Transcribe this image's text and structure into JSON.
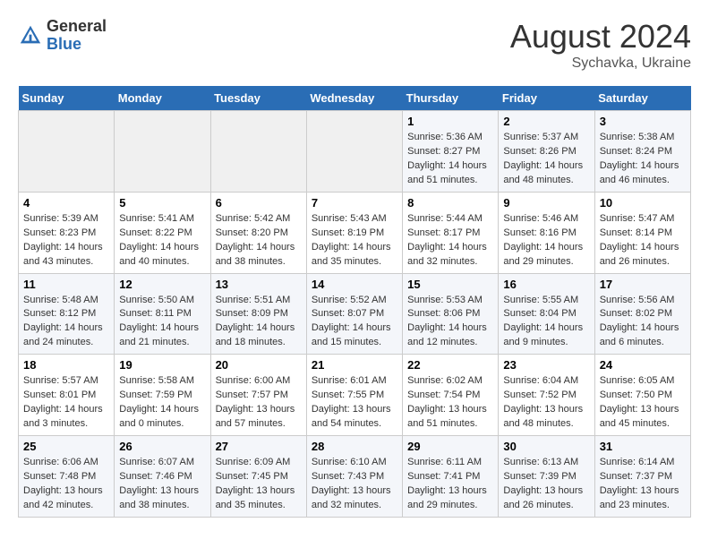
{
  "header": {
    "logo_general": "General",
    "logo_blue": "Blue",
    "month_year": "August 2024",
    "location": "Sychavka, Ukraine"
  },
  "days_of_week": [
    "Sunday",
    "Monday",
    "Tuesday",
    "Wednesday",
    "Thursday",
    "Friday",
    "Saturday"
  ],
  "weeks": [
    [
      {
        "day": "",
        "info": ""
      },
      {
        "day": "",
        "info": ""
      },
      {
        "day": "",
        "info": ""
      },
      {
        "day": "",
        "info": ""
      },
      {
        "day": "1",
        "info": "Sunrise: 5:36 AM\nSunset: 8:27 PM\nDaylight: 14 hours\nand 51 minutes."
      },
      {
        "day": "2",
        "info": "Sunrise: 5:37 AM\nSunset: 8:26 PM\nDaylight: 14 hours\nand 48 minutes."
      },
      {
        "day": "3",
        "info": "Sunrise: 5:38 AM\nSunset: 8:24 PM\nDaylight: 14 hours\nand 46 minutes."
      }
    ],
    [
      {
        "day": "4",
        "info": "Sunrise: 5:39 AM\nSunset: 8:23 PM\nDaylight: 14 hours\nand 43 minutes."
      },
      {
        "day": "5",
        "info": "Sunrise: 5:41 AM\nSunset: 8:22 PM\nDaylight: 14 hours\nand 40 minutes."
      },
      {
        "day": "6",
        "info": "Sunrise: 5:42 AM\nSunset: 8:20 PM\nDaylight: 14 hours\nand 38 minutes."
      },
      {
        "day": "7",
        "info": "Sunrise: 5:43 AM\nSunset: 8:19 PM\nDaylight: 14 hours\nand 35 minutes."
      },
      {
        "day": "8",
        "info": "Sunrise: 5:44 AM\nSunset: 8:17 PM\nDaylight: 14 hours\nand 32 minutes."
      },
      {
        "day": "9",
        "info": "Sunrise: 5:46 AM\nSunset: 8:16 PM\nDaylight: 14 hours\nand 29 minutes."
      },
      {
        "day": "10",
        "info": "Sunrise: 5:47 AM\nSunset: 8:14 PM\nDaylight: 14 hours\nand 26 minutes."
      }
    ],
    [
      {
        "day": "11",
        "info": "Sunrise: 5:48 AM\nSunset: 8:12 PM\nDaylight: 14 hours\nand 24 minutes."
      },
      {
        "day": "12",
        "info": "Sunrise: 5:50 AM\nSunset: 8:11 PM\nDaylight: 14 hours\nand 21 minutes."
      },
      {
        "day": "13",
        "info": "Sunrise: 5:51 AM\nSunset: 8:09 PM\nDaylight: 14 hours\nand 18 minutes."
      },
      {
        "day": "14",
        "info": "Sunrise: 5:52 AM\nSunset: 8:07 PM\nDaylight: 14 hours\nand 15 minutes."
      },
      {
        "day": "15",
        "info": "Sunrise: 5:53 AM\nSunset: 8:06 PM\nDaylight: 14 hours\nand 12 minutes."
      },
      {
        "day": "16",
        "info": "Sunrise: 5:55 AM\nSunset: 8:04 PM\nDaylight: 14 hours\nand 9 minutes."
      },
      {
        "day": "17",
        "info": "Sunrise: 5:56 AM\nSunset: 8:02 PM\nDaylight: 14 hours\nand 6 minutes."
      }
    ],
    [
      {
        "day": "18",
        "info": "Sunrise: 5:57 AM\nSunset: 8:01 PM\nDaylight: 14 hours\nand 3 minutes."
      },
      {
        "day": "19",
        "info": "Sunrise: 5:58 AM\nSunset: 7:59 PM\nDaylight: 14 hours\nand 0 minutes."
      },
      {
        "day": "20",
        "info": "Sunrise: 6:00 AM\nSunset: 7:57 PM\nDaylight: 13 hours\nand 57 minutes."
      },
      {
        "day": "21",
        "info": "Sunrise: 6:01 AM\nSunset: 7:55 PM\nDaylight: 13 hours\nand 54 minutes."
      },
      {
        "day": "22",
        "info": "Sunrise: 6:02 AM\nSunset: 7:54 PM\nDaylight: 13 hours\nand 51 minutes."
      },
      {
        "day": "23",
        "info": "Sunrise: 6:04 AM\nSunset: 7:52 PM\nDaylight: 13 hours\nand 48 minutes."
      },
      {
        "day": "24",
        "info": "Sunrise: 6:05 AM\nSunset: 7:50 PM\nDaylight: 13 hours\nand 45 minutes."
      }
    ],
    [
      {
        "day": "25",
        "info": "Sunrise: 6:06 AM\nSunset: 7:48 PM\nDaylight: 13 hours\nand 42 minutes."
      },
      {
        "day": "26",
        "info": "Sunrise: 6:07 AM\nSunset: 7:46 PM\nDaylight: 13 hours\nand 38 minutes."
      },
      {
        "day": "27",
        "info": "Sunrise: 6:09 AM\nSunset: 7:45 PM\nDaylight: 13 hours\nand 35 minutes."
      },
      {
        "day": "28",
        "info": "Sunrise: 6:10 AM\nSunset: 7:43 PM\nDaylight: 13 hours\nand 32 minutes."
      },
      {
        "day": "29",
        "info": "Sunrise: 6:11 AM\nSunset: 7:41 PM\nDaylight: 13 hours\nand 29 minutes."
      },
      {
        "day": "30",
        "info": "Sunrise: 6:13 AM\nSunset: 7:39 PM\nDaylight: 13 hours\nand 26 minutes."
      },
      {
        "day": "31",
        "info": "Sunrise: 6:14 AM\nSunset: 7:37 PM\nDaylight: 13 hours\nand 23 minutes."
      }
    ]
  ]
}
